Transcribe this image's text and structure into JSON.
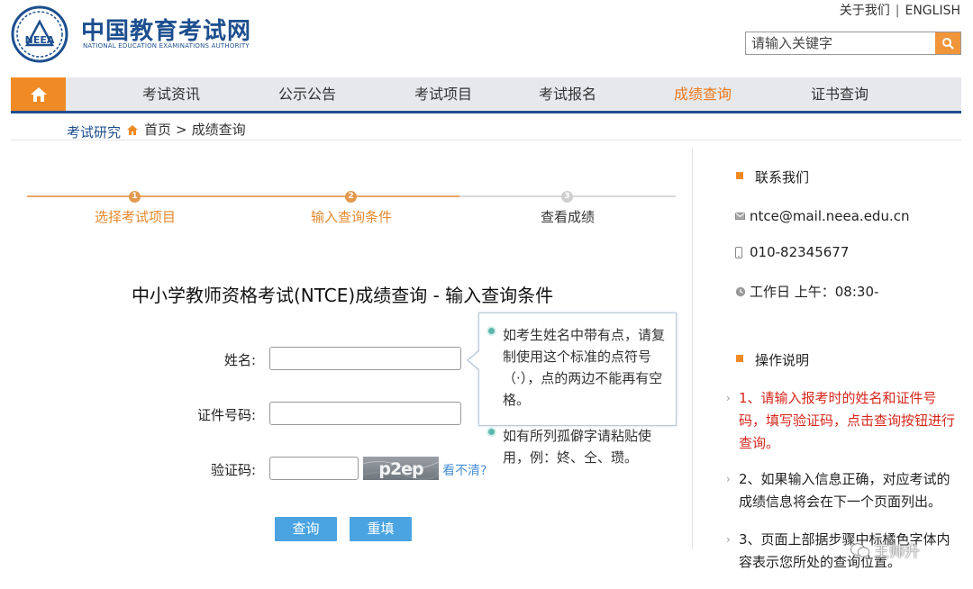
{
  "header": {
    "brand_cn": "中国教育考试网",
    "brand_en": "NATIONAL EDUCATION EXAMINATIONS AUTHORITY",
    "logo_text": "NEEA",
    "top_links": {
      "about": "关于我们",
      "separator": "|",
      "english": "ENGLISH"
    },
    "search": {
      "placeholder": "请输入关键字"
    }
  },
  "nav": {
    "items": [
      {
        "label": "考试资讯"
      },
      {
        "label": "公示公告"
      },
      {
        "label": "考试项目"
      },
      {
        "label": "考试报名"
      },
      {
        "label": "成绩查询",
        "active": true
      },
      {
        "label": "证书查询"
      }
    ],
    "accent": "#f08a24",
    "brand_blue": "#1d4f8f"
  },
  "breadcrumb": {
    "left_label": "考试研究",
    "home": "首页",
    "separator": ">",
    "current": "成绩查询"
  },
  "steps": [
    {
      "num": "1",
      "label": "选择考试项目",
      "state": "done"
    },
    {
      "num": "2",
      "label": "输入查询条件",
      "state": "done"
    },
    {
      "num": "3",
      "label": "查看成绩",
      "state": "todo"
    }
  ],
  "form": {
    "title": "中小学教师资格考试(NTCE)成绩查询 - 输入查询条件",
    "name_label": "姓名:",
    "id_label": "证件号码:",
    "captcha_label": "验证码:",
    "name_value": "",
    "id_value": "",
    "captcha_value": "",
    "captcha_text": "p2ep",
    "captcha_refresh": "看不清?",
    "submit": "查询",
    "reset": "重填"
  },
  "tooltip": {
    "line1": "如考生姓名中带有点，请复制使用这个标准的点符号（·），点的两边不能再有空格。",
    "line2": "如有所列孤僻字请粘贴使用，例：㚵、仝、瓒。"
  },
  "sidebar": {
    "contact_title": "联系我们",
    "email": "ntce@mail.neea.edu.cn",
    "phone": "010-82345677",
    "hours": "工作日 上午：08:30-",
    "guide_title": "操作说明",
    "guide": [
      "1、请输入报考时的姓名和证件号码，填写验证码，点击查询按钮进行查询。",
      "2、如果输入信息正确，对应考试的成绩信息将会在下一个页面列出。",
      "3、页面上部据步骤中标橘色字体内容表示您所处的查询位置。"
    ]
  },
  "watermark": "王帅升"
}
